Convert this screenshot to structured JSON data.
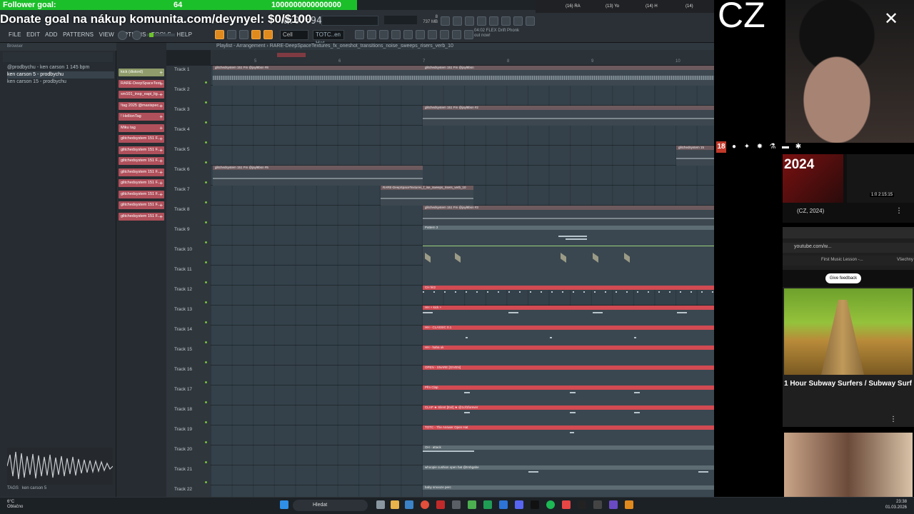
{
  "overlay": {
    "follower_goal": "Follower goal:",
    "follower_count": "64",
    "follower_target": "1000000000000000",
    "donate": "Donate goal na nákup komunita.com/deynyel: $0/$100",
    "channel_tag": "CZ"
  },
  "fl": {
    "menu": [
      "FILE",
      "EDIT",
      "ADD",
      "PATTERNS",
      "VIEW",
      "OPTIONS",
      "TOOLS",
      "HELP"
    ],
    "time": "0:07:94",
    "cpu": "8",
    "mem": "737 MB",
    "snap": "Cell",
    "pattern": "TOTC..en Hat",
    "news": "04:02 FLEX Drift Phonk out now!",
    "browser_header": "Browser",
    "browser_items": [
      "@prodbychu - ken carson 1 145 bpm",
      "ken carson 5 - prodbychu",
      "ken carson 15 - prodbychu"
    ],
    "browser_footer_tags": "TAGS",
    "browser_footer_file": "ken carson 5",
    "channels": [
      {
        "label": "kick (distord)",
        "color": "#8f9b6a"
      },
      {
        "label": "RARE-DeepSpaceText...",
        "color": "#b0505b"
      },
      {
        "label": "sm101_insp_eapi_lig...",
        "color": "#b0505b"
      },
      {
        "label": "!tag 2025 @maxispec...",
        "color": "#b0505b"
      },
      {
        "label": "! HellionTag",
        "color": "#b0505b"
      },
      {
        "label": "Miku tag",
        "color": "#b0505b"
      },
      {
        "label": "glitchedsystem 151 F...",
        "color": "#b0505b"
      },
      {
        "label": "glitchedsystem 151 F...",
        "color": "#b0505b"
      },
      {
        "label": "glitchedsystem 151 F...",
        "color": "#b0505b"
      },
      {
        "label": "glitchedsystem 151 F...",
        "color": "#b0505b"
      },
      {
        "label": "glitchedsystem 151 F...",
        "color": "#b0505b"
      },
      {
        "label": "glitchedsystem 151 F...",
        "color": "#b0505b"
      },
      {
        "label": "glitchedsystem 151 F...",
        "color": "#b0505b"
      },
      {
        "label": "glitchedsystem 151 F...",
        "color": "#b0505b"
      }
    ],
    "playlist_title": "Playlist - Arrangement  ›  RARE-DeepSpaceTextures_fx_oneshot_transitions_noise_sweeps_risers_verb_10",
    "ruler": [
      "5",
      "6",
      "7",
      "8",
      "9",
      "10",
      "11",
      "12"
    ],
    "tracks": [
      "Track 1",
      "Track 2",
      "Track 3",
      "Track 4",
      "Track 5",
      "Track 6",
      "Track 7",
      "Track 8",
      "Track 9",
      "Track 10",
      "Track 11",
      "Track 12",
      "Track 13",
      "Track 14",
      "Track 15",
      "Track 16",
      "Track 17",
      "Track 18",
      "Track 19",
      "Track 20",
      "Track 21",
      "Track 22"
    ],
    "clips": {
      "t1a": "glitchedsystem 151 Fm @jayl8bsn #8",
      "t1b": "glitchedsystem 151 Fm @jayl8bsn",
      "t3": "glitchedsystem 151 Fm @jayl8bsn #2",
      "t5": "glitchedsystem 15",
      "t6": "glitchedsystem 151 Fm @jayl8bsn #5",
      "t7": "RARE-DeepSpaceTextures_f_ise_sweeps_risers_verb_10",
      "t8": "glitchedsystem 151 Fm @jayl8bsn #3",
      "t9": "Pattern 3",
      "t12": "CH hit2",
      "t13": "HH + kick +",
      "t14": "HH - CLASSIC 0.1",
      "t15": "HH - haha uk",
      "t16": "OPEN - SNARE [GIVEN]",
      "t17": "Pfm Clap",
      "t18": "CLAP ★ Silent [Evil] ★ @1of1forever",
      "t19": "TOTC - The Answer Open Hat",
      "t20": "OH - attack",
      "t21": "whoopie cushion open hat @tmbgabe",
      "t22": "baby smooze perc"
    }
  },
  "chrome_tabs": [
    "(16) RA",
    "(13) Yo",
    "(14) H",
    "(14)"
  ],
  "stream": {
    "yt_year": "2024",
    "yt_label": "(CZ, 2024)",
    "yt_time": "1:0 2:15:15",
    "browser_url": "youtube.com/w...",
    "bookmark": "First Music Lesson -...",
    "bookmark2": "Všechny",
    "feedback": "Give feedback",
    "video_title": "1 Hour Subway Surfers / Subway Surf"
  },
  "taskbar": {
    "weather_temp": "6°C",
    "weather_desc": "Oblačno",
    "search": "Hledat",
    "time": "23:38",
    "date": "01.03.2026"
  }
}
